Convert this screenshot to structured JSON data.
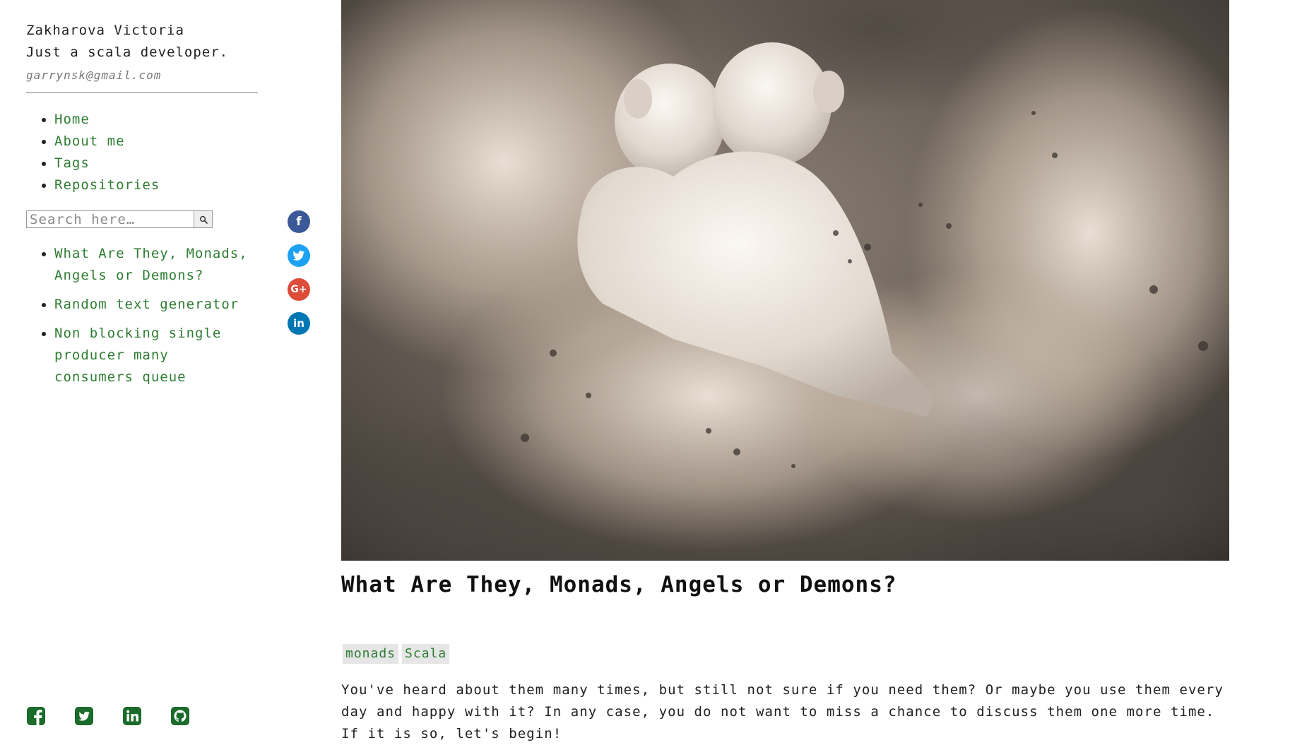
{
  "author": {
    "name": "Zakharova Victoria",
    "tagline": "Just a scala developer.",
    "email": "garrynsk@gmail.com"
  },
  "nav": {
    "items": [
      {
        "label": "Home"
      },
      {
        "label": "About me"
      },
      {
        "label": "Tags"
      },
      {
        "label": "Repositories"
      }
    ]
  },
  "search": {
    "placeholder": "Search here…",
    "button_icon": "magnifier-icon"
  },
  "recent_posts": [
    {
      "title": "What Are They, Monads, Angels or Demons?"
    },
    {
      "title": "Random text generator"
    },
    {
      "title": "Non blocking single producer many consumers queue"
    }
  ],
  "share": [
    {
      "network": "facebook",
      "glyph": "f",
      "color": "#3b5998"
    },
    {
      "network": "twitter",
      "glyph": "t",
      "color": "#1da1f2"
    },
    {
      "network": "google-plus",
      "glyph": "G+",
      "color": "#dd4b39"
    },
    {
      "network": "linkedin",
      "glyph": "in",
      "color": "#0077b5"
    }
  ],
  "footer_icons": [
    "facebook-square-icon",
    "twitter-square-icon",
    "linkedin-square-icon",
    "github-square-icon"
  ],
  "colors": {
    "link": "#2e7d32",
    "footer_icon": "#1b6b2a",
    "tag_bg": "#e6e6e6"
  },
  "post": {
    "hero_alt": "two angel figurines in a cloud of dust",
    "title": "What Are They, Monads, Angels or Demons?",
    "tags": [
      "monads",
      "Scala"
    ],
    "intro": "You've heard about them many times, but still not sure if you need them? Or maybe you use them every day and happy with it? In any case, you do not want to miss a chance to discuss them one more time. If it is so, let's begin!"
  }
}
